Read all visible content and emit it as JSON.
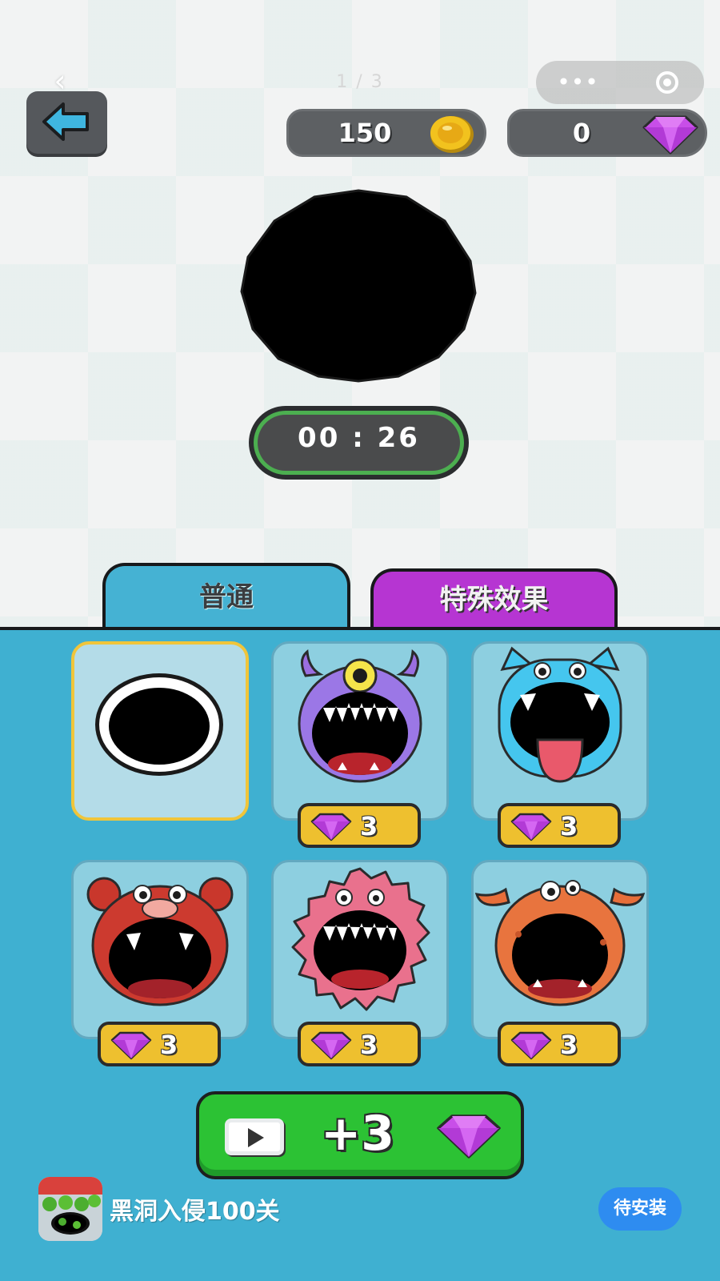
{
  "header": {
    "back_glyph": "‹",
    "page_indicator": "1 / 3",
    "capsule_menu": "•••"
  },
  "currency": {
    "coins": "150",
    "gems": "0"
  },
  "timer": {
    "text": "00 : 26"
  },
  "tabs": [
    {
      "label": "普通",
      "active": true
    },
    {
      "label": "特殊效果",
      "active": false
    }
  ],
  "skins": [
    {
      "name": "classic-hole",
      "selected": true
    },
    {
      "name": "purple-cyclops-monster",
      "price": "3"
    },
    {
      "name": "blue-cat-monster",
      "price": "3"
    },
    {
      "name": "red-bear-monster",
      "price": "3"
    },
    {
      "name": "pink-furry-monster",
      "price": "3"
    },
    {
      "name": "orange-horned-monster",
      "price": "3"
    }
  ],
  "reward_button": {
    "label": "+3"
  },
  "install_bar": {
    "app_name": "黑洞入侵100关",
    "button_label": "待安装"
  },
  "colors": {
    "panel": "#3fb0d1",
    "tab_special": "#b635d2",
    "price_tag": "#eec02f",
    "reward_green": "#2cc234",
    "install_blue": "#2e8cf0"
  }
}
